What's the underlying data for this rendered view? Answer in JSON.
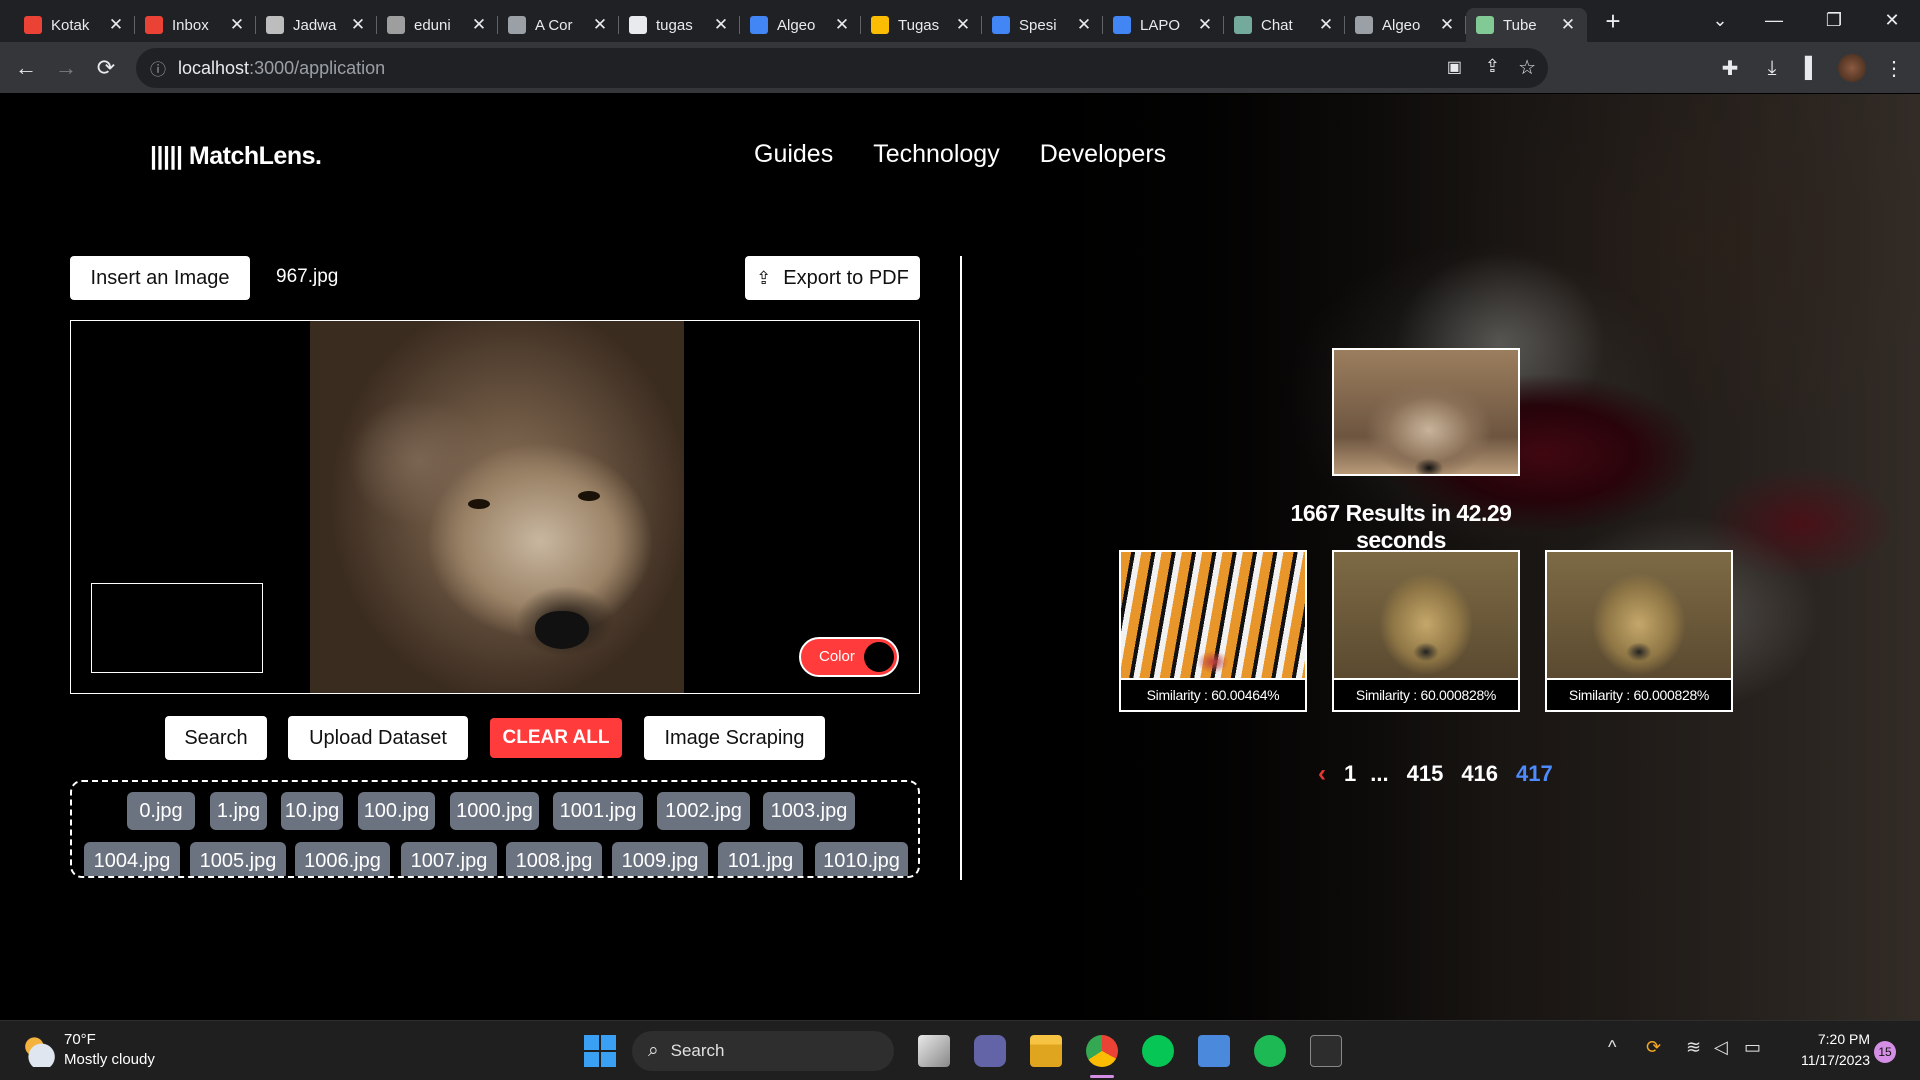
{
  "browser": {
    "tabs": [
      {
        "title": "Kotak",
        "color": "#ea4335"
      },
      {
        "title": "Inbox",
        "color": "#ea4335"
      },
      {
        "title": "Jadwa",
        "color": "#bdbdbd"
      },
      {
        "title": "eduni",
        "color": "#9e9e9e"
      },
      {
        "title": "A Cor",
        "color": "#9aa0a6"
      },
      {
        "title": "tugas",
        "color": "#e8eaed"
      },
      {
        "title": "Algeo",
        "color": "#4285f4"
      },
      {
        "title": "Tugas",
        "color": "#fbbc04"
      },
      {
        "title": "Spesi",
        "color": "#4285f4"
      },
      {
        "title": "LAPO",
        "color": "#4285f4"
      },
      {
        "title": "Chat",
        "color": "#74aa9c"
      },
      {
        "title": "Algeo",
        "color": "#9aa0a6"
      },
      {
        "title": "Tube",
        "color": "#81c995"
      }
    ],
    "active_tab": 12,
    "close_glyph": "✕",
    "new_tab": "+",
    "url_host": "localhost",
    "url_path": ":3000/application",
    "icons": {
      "back": "←",
      "forward": "→",
      "reload": "⟳",
      "info": "ⓘ",
      "share": "⇪",
      "star": "☆",
      "extensions": "✚",
      "download": "⤓",
      "sidebar": "▌",
      "menu": "⋮",
      "camera_off": "▣"
    }
  },
  "app": {
    "logo": "||||| MatchLens.",
    "nav": [
      "Guides",
      "Technology",
      "Developers"
    ],
    "insert_button": "Insert an Image",
    "filename": "967.jpg",
    "export_button": "Export to PDF",
    "export_icon": "⇪",
    "color_toggle": "Color",
    "actions": {
      "search": "Search",
      "upload": "Upload Dataset",
      "clear": "CLEAR ALL",
      "scrape": "Image Scraping"
    },
    "dataset_files": [
      "0.jpg",
      "1.jpg",
      "10.jpg",
      "100.jpg",
      "1000.jpg",
      "1001.jpg",
      "1002.jpg",
      "1003.jpg",
      "1004.jpg",
      "1005.jpg",
      "1006.jpg",
      "1007.jpg",
      "1008.jpg",
      "1009.jpg",
      "101.jpg",
      "1010.jpg"
    ],
    "results_text": "1667 Results in 42.29 seconds",
    "results": [
      {
        "similarity": "Similarity : 60.00464%",
        "image": "tiger"
      },
      {
        "similarity": "Similarity : 60.000828%",
        "image": "lion"
      },
      {
        "similarity": "Similarity : 60.000828%",
        "image": "lion"
      }
    ],
    "pagination": {
      "prev": "‹",
      "pages": [
        "1",
        "...",
        "415",
        "416",
        "417"
      ],
      "current": "417"
    }
  },
  "taskbar": {
    "weather_temp": "70°F",
    "weather_desc": "Mostly cloudy",
    "search": "Search",
    "time": "7:20 PM",
    "date": "11/17/2023",
    "notifications": "15",
    "tray_chevron": "^"
  }
}
